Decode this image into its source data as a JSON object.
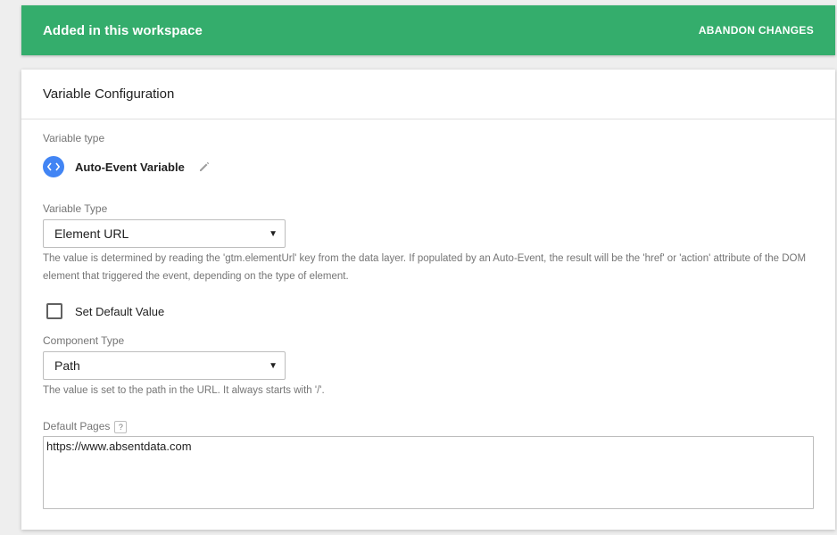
{
  "banner": {
    "title": "Added in this workspace",
    "action_label": "ABANDON CHANGES",
    "color": "#34ad6c"
  },
  "card": {
    "title": "Variable Configuration",
    "variable_type_section": {
      "label": "Variable type",
      "type_name": "Auto-Event Variable",
      "icon": "code-brackets-icon",
      "edit_icon": "pencil-icon",
      "icon_color": "#4285f4"
    },
    "variable_type_select": {
      "label": "Variable Type",
      "value": "Element URL",
      "help": "The value is determined by reading the 'gtm.elementUrl' key from the data layer. If populated by an Auto-Event, the result will be the 'href' or 'action' attribute of the DOM element that triggered the event, depending on the type of element."
    },
    "default_value_checkbox": {
      "label": "Set Default Value",
      "checked": false
    },
    "component_type_select": {
      "label": "Component Type",
      "value": "Path",
      "help": "The value is set to the path in the URL. It always starts with '/'."
    },
    "default_pages": {
      "label": "Default Pages",
      "help_badge": "?",
      "value": "https://www.absentdata.com"
    }
  }
}
